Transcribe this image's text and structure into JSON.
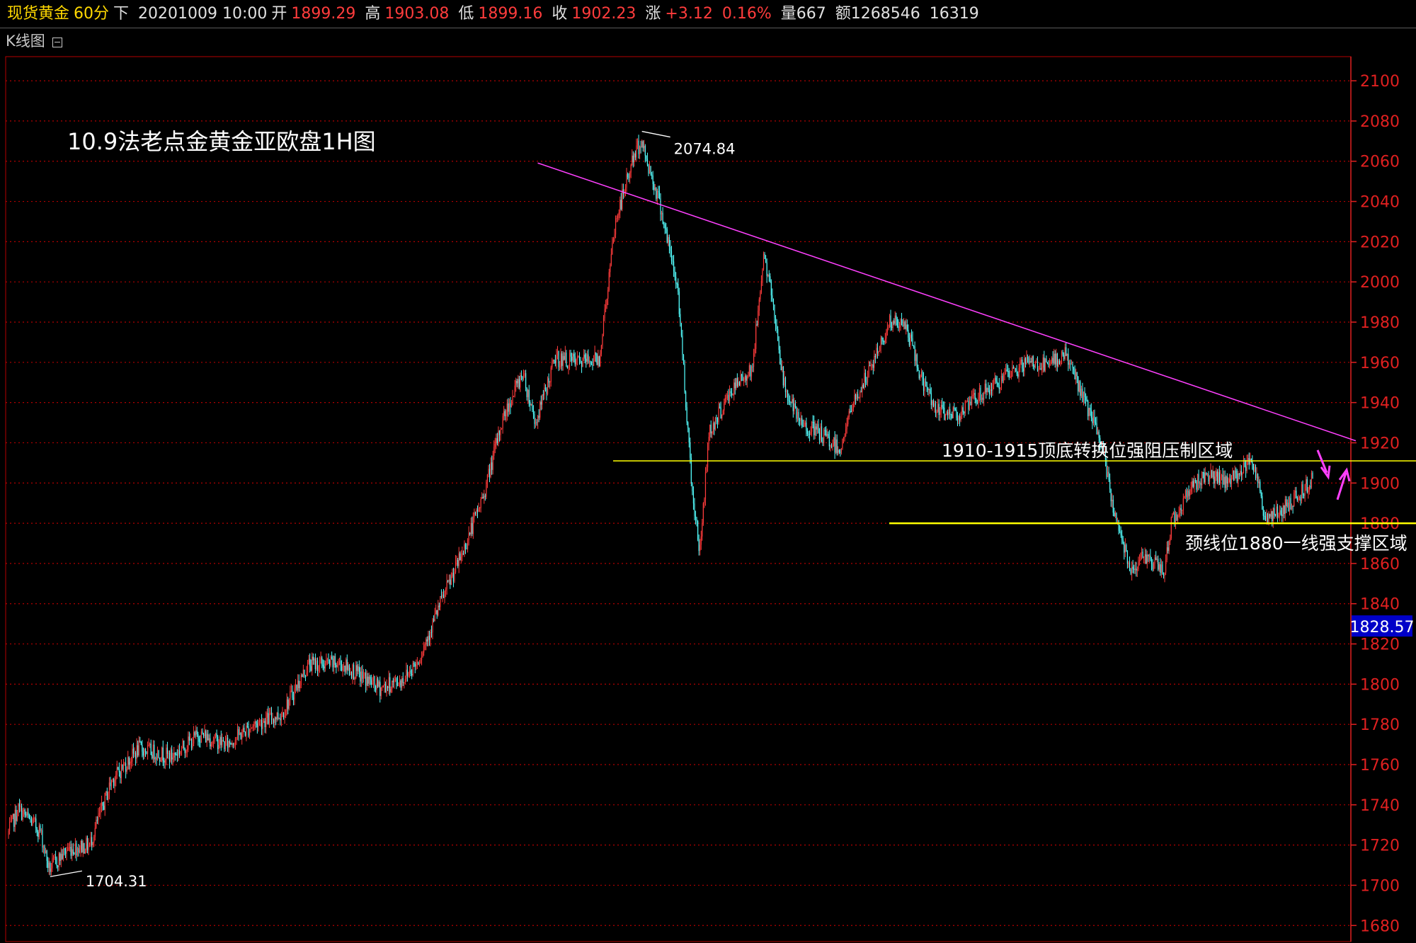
{
  "header": {
    "instrument": "现货黄金",
    "period": "60分",
    "direction": "下",
    "datetime": "20201009 10:00",
    "open_label": "开",
    "open": "1899.29",
    "high_label": "高",
    "high": "1903.08",
    "low_label": "低",
    "low": "1899.16",
    "close_label": "收",
    "close": "1902.23",
    "change_label": "涨",
    "change": "+3.12",
    "change_pct": "0.16%",
    "volume_label": "量667",
    "amount_label": "额1268546",
    "extra": "16319"
  },
  "subbar": {
    "title": "K线图"
  },
  "colors": {
    "up": "#ff3c3c",
    "down": "#54ffff",
    "grid": "#b40000",
    "axis": "#e02020",
    "trendline": "#ff40ff",
    "support": "#ffff00",
    "current_price_bg": "#0000c8"
  },
  "chart_data": {
    "type": "candlestick",
    "title": "10.9法老点金黄金亚欧盘1H图",
    "ylim": [
      1672,
      2112
    ],
    "y_ticks": [
      1680,
      1700,
      1720,
      1740,
      1760,
      1780,
      1800,
      1820,
      1840,
      1860,
      1880,
      1900,
      1920,
      1940,
      1960,
      1980,
      2000,
      2020,
      2040,
      2060,
      2080,
      2100
    ],
    "current_price": "1828.57",
    "anchors": [
      [
        0,
        1725
      ],
      [
        10,
        1738
      ],
      [
        30,
        1727
      ],
      [
        38,
        1708
      ],
      [
        55,
        1718
      ],
      [
        75,
        1720
      ],
      [
        95,
        1752
      ],
      [
        120,
        1768
      ],
      [
        150,
        1764
      ],
      [
        175,
        1775
      ],
      [
        200,
        1770
      ],
      [
        225,
        1780
      ],
      [
        250,
        1785
      ],
      [
        275,
        1810
      ],
      [
        305,
        1810
      ],
      [
        340,
        1798
      ],
      [
        360,
        1802
      ],
      [
        375,
        1812
      ],
      [
        395,
        1840
      ],
      [
        415,
        1865
      ],
      [
        435,
        1895
      ],
      [
        452,
        1932
      ],
      [
        470,
        1955
      ],
      [
        482,
        1930
      ],
      [
        500,
        1962
      ],
      [
        520,
        1960
      ],
      [
        540,
        1962
      ],
      [
        555,
        2030
      ],
      [
        570,
        2060
      ],
      [
        578,
        2070
      ],
      [
        595,
        2040
      ],
      [
        612,
        1995
      ],
      [
        625,
        1895
      ],
      [
        632,
        1866
      ],
      [
        640,
        1925
      ],
      [
        660,
        1945
      ],
      [
        680,
        1958
      ],
      [
        690,
        2014
      ],
      [
        700,
        1985
      ],
      [
        708,
        1950
      ],
      [
        722,
        1930
      ],
      [
        740,
        1925
      ],
      [
        760,
        1917
      ],
      [
        770,
        1937
      ],
      [
        790,
        1960
      ],
      [
        805,
        1980
      ],
      [
        820,
        1978
      ],
      [
        835,
        1950
      ],
      [
        850,
        1935
      ],
      [
        870,
        1935
      ],
      [
        890,
        1945
      ],
      [
        910,
        1952
      ],
      [
        930,
        1960
      ],
      [
        950,
        1958
      ],
      [
        965,
        1965
      ],
      [
        980,
        1945
      ],
      [
        998,
        1920
      ],
      [
        1010,
        1885
      ],
      [
        1025,
        1858
      ],
      [
        1040,
        1864
      ],
      [
        1055,
        1855
      ],
      [
        1062,
        1880
      ],
      [
        1080,
        1898
      ],
      [
        1095,
        1905
      ],
      [
        1110,
        1900
      ],
      [
        1125,
        1905
      ],
      [
        1135,
        1915
      ],
      [
        1148,
        1882
      ],
      [
        1160,
        1885
      ],
      [
        1180,
        1895
      ],
      [
        1190,
        1902
      ]
    ],
    "candle_count": 1191,
    "annotations": [
      {
        "text": "2074.84",
        "index": 578,
        "price": 2074.84,
        "position": "above"
      },
      {
        "text": "1704.31",
        "index": 38,
        "price": 1704.31,
        "position": "below"
      },
      {
        "text": "1910-1915顶底转换位强阻压制区域",
        "type": "hline",
        "price": 1911
      },
      {
        "text": "颈线位1880一线强支撑区域",
        "type": "hline",
        "price": 1880
      }
    ],
    "trendline": {
      "from": [
        470,
        2057
      ],
      "to": [
        1210,
        1921
      ]
    }
  }
}
